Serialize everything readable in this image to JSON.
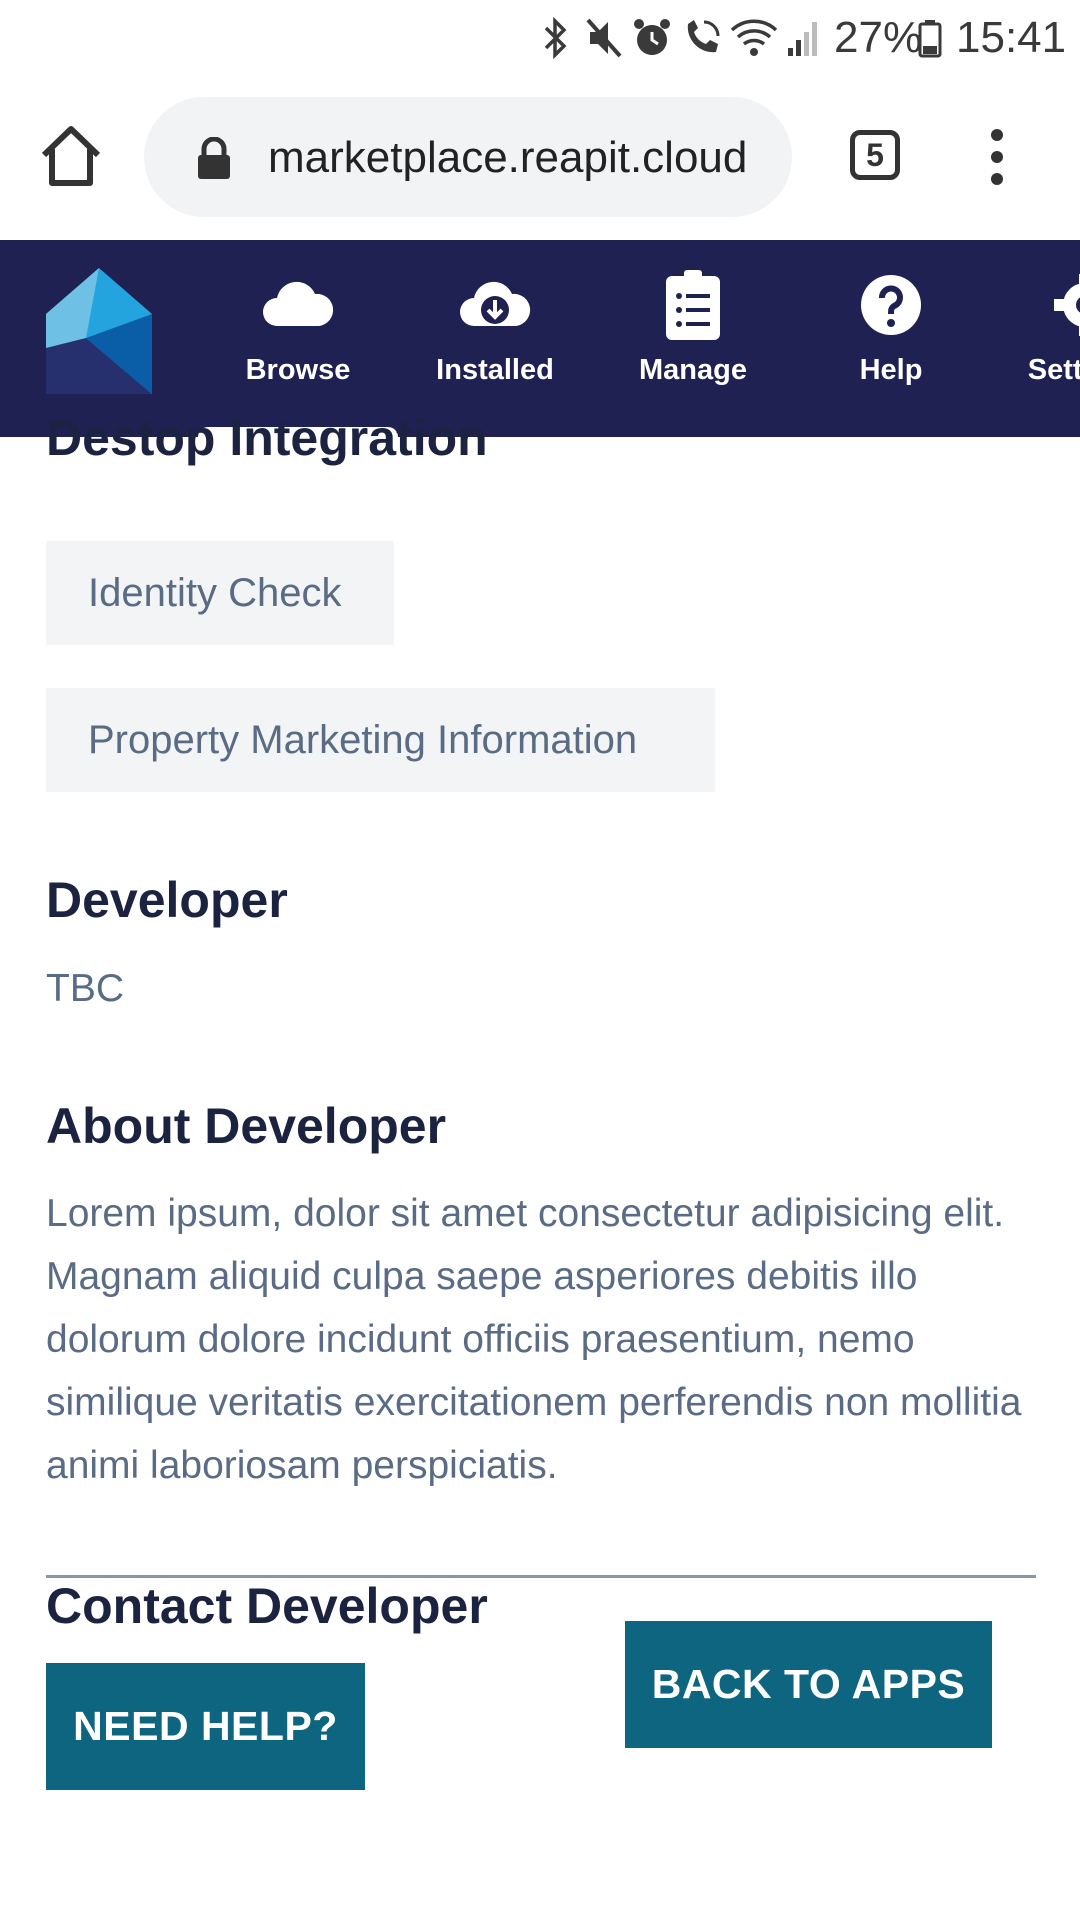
{
  "status_bar": {
    "battery_percent": "27%",
    "time": "15:41",
    "icons": [
      "bluetooth-icon",
      "mute-icon",
      "alarm-icon",
      "wifi-call-icon",
      "wifi-icon",
      "signal-icon",
      "battery-icon"
    ]
  },
  "browser": {
    "url": "marketplace.reapit.cloud",
    "tab_count": "5"
  },
  "app_nav": {
    "items": [
      {
        "label": "Browse",
        "icon": "cloud-icon",
        "active": true
      },
      {
        "label": "Installed",
        "icon": "cloud-download-icon"
      },
      {
        "label": "Manage",
        "icon": "clipboard-list-icon"
      },
      {
        "label": "Help",
        "icon": "question-circle-icon"
      },
      {
        "label": "Settings",
        "icon": "gear-icon"
      }
    ],
    "colors": {
      "background": "#1e2151",
      "logo_light": "#6ec1e4",
      "logo_mid": "#23a4de",
      "logo_dark": "#0a5ea8"
    }
  },
  "content": {
    "integration_heading": "Destop Integration",
    "integrations": [
      "Identity Check",
      "Property Marketing Information"
    ],
    "developer_heading": "Developer",
    "developer_value": "TBC",
    "about_heading": "About Developer",
    "about_text": "Lorem ipsum, dolor sit amet consectetur adipisicing elit. Magnam aliquid culpa saepe asperiores debitis illo dolorum dolore incidunt officiis praesentium, nemo similique veritatis exercitationem perferendis non mollitia animi laboriosam perspiciatis.",
    "contact_heading": "Contact Developer",
    "need_help_label": "NEED HELP?",
    "back_label": "BACK TO APPS"
  },
  "colors": {
    "button": "#0e6580",
    "heading": "#1c2340",
    "body_text": "#5a6b85",
    "chip_bg": "#f3f4f5"
  }
}
